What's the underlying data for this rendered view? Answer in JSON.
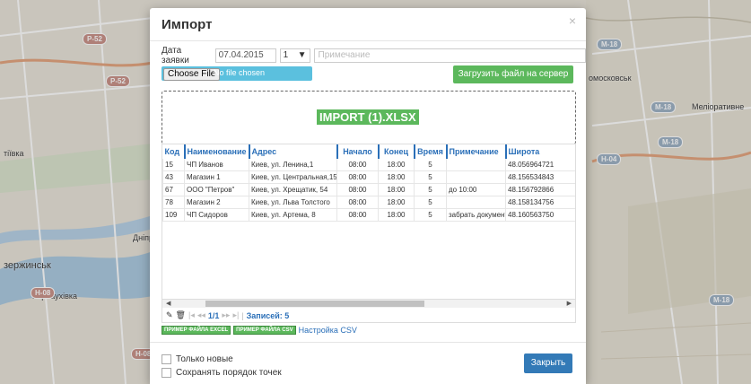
{
  "map": {
    "labels": [
      "тіївка",
      "Дніпр",
      "зержинськ",
      "Карнаухівка",
      "омосковськ",
      "Меліоративне"
    ],
    "shields": [
      "Р-52",
      "Р-52",
      "Н-08",
      "Н-08",
      "М-18",
      "М-18",
      "М-18",
      "Н-04",
      "М-18"
    ]
  },
  "dialog": {
    "title": "Импорт",
    "close_icon": "×",
    "date_label": "Дата заявки",
    "date_value": "07.04.2015",
    "number_value": "1",
    "note_placeholder": "Примечание",
    "choose_file": "Choose File",
    "no_file": "No file chosen",
    "upload_label": "Загрузить файл на сервер",
    "file_name": "IMPORT (1).XLSX"
  },
  "table": {
    "headers": [
      "Код",
      "Наименование",
      "Адрес",
      "Начало",
      "Конец",
      "Время",
      "Примечание",
      "Широта"
    ],
    "rows": [
      [
        "15",
        "ЧП Иванов",
        "Киев, ул. Ленина,1",
        "08:00",
        "18:00",
        "5",
        "",
        "48.056964721"
      ],
      [
        "43",
        "Магазин 1",
        "Киев, ул. Центральная,15",
        "08:00",
        "18:00",
        "5",
        "",
        "48.156534843"
      ],
      [
        "67",
        "ООО \"Петров\"",
        "Киев, ул. Хрещатик, 54",
        "08:00",
        "18:00",
        "5",
        "до 10:00",
        "48.156792866"
      ],
      [
        "78",
        "Магазин 2",
        "Киев, ул. Льва Толстого",
        "08:00",
        "18:00",
        "5",
        "",
        "48.158134756"
      ],
      [
        "109",
        "ЧП Сидоров",
        "Киев, ул. Артема, 8",
        "08:00",
        "18:00",
        "5",
        "забрать документы",
        "48.160563750"
      ]
    ]
  },
  "pager": {
    "page": "1/1",
    "records_label": "Записей: 5"
  },
  "links": {
    "excel": "ПРИМЕР ФАЙЛА EXCEL",
    "csv": "ПРИМЕР ФАЙЛА CSV",
    "csv_settings": "Настройка CSV"
  },
  "footer": {
    "only_new": "Только новые",
    "keep_order": "Сохранять порядок точек",
    "close": "Закрыть"
  }
}
